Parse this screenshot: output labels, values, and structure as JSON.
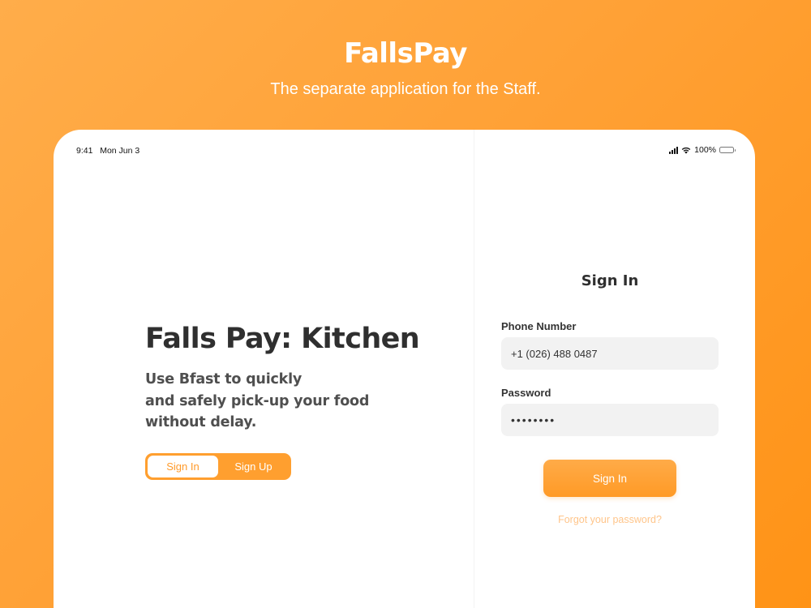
{
  "page": {
    "title": "FallsPay",
    "subtitle": "The separate application for the Staff."
  },
  "status_bar": {
    "time": "9:41",
    "date": "Mon Jun 3",
    "battery": "100%",
    "icons": [
      "signal-icon",
      "wifi-icon",
      "battery-icon"
    ]
  },
  "welcome": {
    "title": "Falls Pay: Kitchen",
    "tagline_lines": [
      "Use Bfast to quickly",
      "and safely pick-up your food",
      "without delay."
    ],
    "segments": [
      "Sign In",
      "Sign Up"
    ],
    "selected_segment": "Sign In"
  },
  "signin_form": {
    "heading": "Sign In",
    "phone_label": "Phone Number",
    "phone_value": "+1 (026) 488 0487",
    "password_label": "Password",
    "password_value": "••••••••",
    "submit_label": "Sign In",
    "forgot_label": "Forgot your password?"
  },
  "colors": {
    "accent": "#FF9F2F",
    "background_gradient": [
      "#FFAD4A",
      "#FF9316"
    ],
    "text_dark": "#2F2F2F",
    "field_background": "#F2F2F2",
    "link": "#FFC58A"
  }
}
